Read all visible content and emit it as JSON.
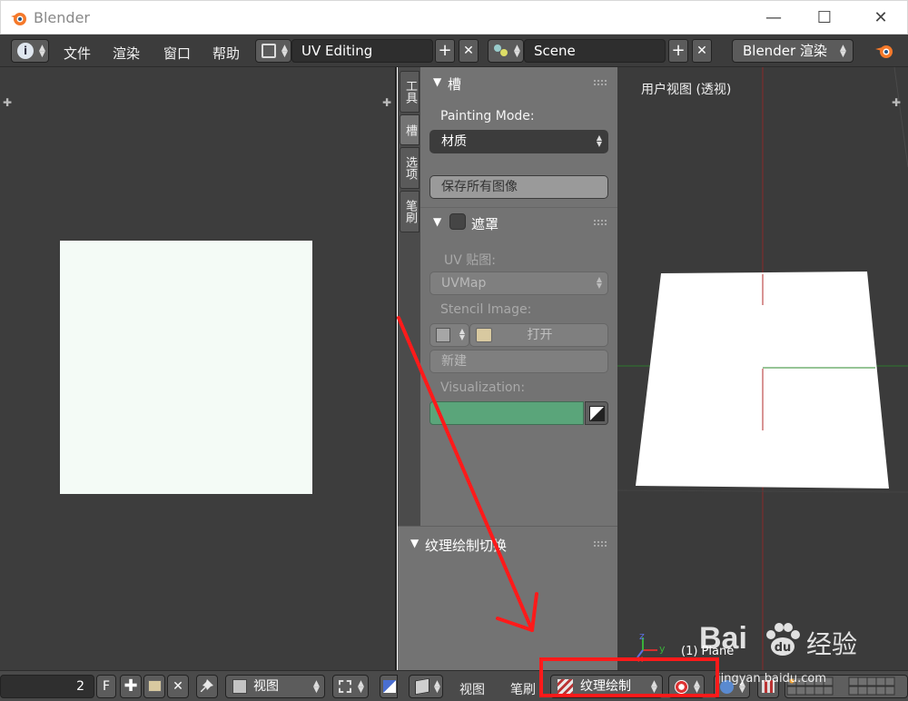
{
  "window": {
    "title": "Blender",
    "controls": {
      "minimize": "—",
      "maximize": "☐",
      "close": "✕"
    }
  },
  "header": {
    "info_icon": "i",
    "menus": [
      "文件",
      "渲染",
      "窗口",
      "帮助"
    ],
    "screen_layout": "UV Editing",
    "scene": "Scene",
    "render_engine": "Blender 渲染",
    "add_symbol": "+",
    "remove_symbol": "✕"
  },
  "tool_tabs": [
    "工具",
    "槽",
    "选项",
    "笔刷"
  ],
  "panel": {
    "slots": {
      "title": "槽",
      "painting_mode_label": "Painting Mode:",
      "painting_mode_value": "材质",
      "save_all_images": "保存所有图像"
    },
    "mask": {
      "title": "遮罩",
      "uv_map_label": "UV 贴图:",
      "uv_map_value": "UVMap",
      "stencil_label": "Stencil Image:",
      "open_button": "打开",
      "new_button": "新建",
      "visualization_label": "Visualization:",
      "visualization_color": "#5aa57a"
    },
    "texture_paint_toggle": {
      "title": "纹理绘制切换"
    }
  },
  "viewport": {
    "view_label": "用户视图 (透视)",
    "object_label": "(1) Plane",
    "axis_x": "x",
    "axis_y": "y",
    "axis_z": "z"
  },
  "uv_editor_header": {
    "frame": "2",
    "fake_user": "F",
    "view_menu": "视图"
  },
  "viewport_header": {
    "view_menu": "视图",
    "brush_menu": "笔刷",
    "mode": "纹理绘制"
  },
  "watermark": {
    "brand": "Bai",
    "brand_suffix": "经验",
    "url": "jingyan.baidu.com"
  },
  "colors": {
    "annotation_red": "#ff1a1a",
    "header_bg": "#3c3c3c",
    "panel_bg": "#737373",
    "uv_image": "#f4fbf6"
  }
}
